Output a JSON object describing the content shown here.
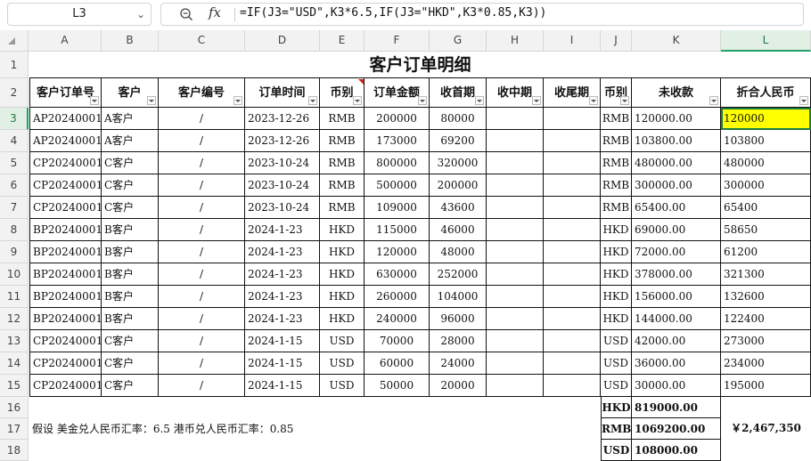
{
  "name_box": "L3",
  "formula": "=IF(J3=\"USD\",K3*6.5,IF(J3=\"HKD\",K3*0.85,K3))",
  "columns": [
    "A",
    "B",
    "C",
    "D",
    "E",
    "F",
    "G",
    "H",
    "I",
    "J",
    "K",
    "L"
  ],
  "row_numbers": [
    "1",
    "2",
    "3",
    "4",
    "5",
    "6",
    "7",
    "8",
    "9",
    "10",
    "11",
    "12",
    "13",
    "14",
    "15",
    "16",
    "17",
    "18"
  ],
  "title": "客户订单明细",
  "headers": [
    "客户订单号",
    "客户",
    "客户编号",
    "订单时间",
    "币别",
    "订单金额",
    "收首期",
    "收中期",
    "收尾期",
    "币别",
    "未收款",
    "折合人民币"
  ],
  "rows": [
    [
      "AP20240001",
      "A客户",
      "/",
      "2023-12-26",
      "RMB",
      "200000",
      "80000",
      "",
      "",
      "RMB",
      "120000.00",
      "120000"
    ],
    [
      "AP20240001",
      "A客户",
      "/",
      "2023-12-26",
      "RMB",
      "173000",
      "69200",
      "",
      "",
      "RMB",
      "103800.00",
      "103800"
    ],
    [
      "CP20240001",
      "C客户",
      "/",
      "2023-10-24",
      "RMB",
      "800000",
      "320000",
      "",
      "",
      "RMB",
      "480000.00",
      "480000"
    ],
    [
      "CP20240001",
      "C客户",
      "/",
      "2023-10-24",
      "RMB",
      "500000",
      "200000",
      "",
      "",
      "RMB",
      "300000.00",
      "300000"
    ],
    [
      "CP20240001",
      "C客户",
      "/",
      "2023-10-24",
      "RMB",
      "109000",
      "43600",
      "",
      "",
      "RMB",
      "65400.00",
      "65400"
    ],
    [
      "BP20240001",
      "B客户",
      "/",
      "2024-1-23",
      "HKD",
      "115000",
      "46000",
      "",
      "",
      "HKD",
      "69000.00",
      "58650"
    ],
    [
      "BP20240001",
      "B客户",
      "/",
      "2024-1-23",
      "HKD",
      "120000",
      "48000",
      "",
      "",
      "HKD",
      "72000.00",
      "61200"
    ],
    [
      "BP20240001",
      "B客户",
      "/",
      "2024-1-23",
      "HKD",
      "630000",
      "252000",
      "",
      "",
      "HKD",
      "378000.00",
      "321300"
    ],
    [
      "BP20240001",
      "B客户",
      "/",
      "2024-1-23",
      "HKD",
      "260000",
      "104000",
      "",
      "",
      "HKD",
      "156000.00",
      "132600"
    ],
    [
      "BP20240001",
      "B客户",
      "/",
      "2024-1-23",
      "HKD",
      "240000",
      "96000",
      "",
      "",
      "HKD",
      "144000.00",
      "122400"
    ],
    [
      "CP20240001",
      "C客户",
      "/",
      "2024-1-15",
      "USD",
      "70000",
      "28000",
      "",
      "",
      "USD",
      "42000.00",
      "273000"
    ],
    [
      "CP20240001",
      "C客户",
      "/",
      "2024-1-15",
      "USD",
      "60000",
      "24000",
      "",
      "",
      "USD",
      "36000.00",
      "234000"
    ],
    [
      "CP20240001",
      "C客户",
      "/",
      "2024-1-15",
      "USD",
      "50000",
      "20000",
      "",
      "",
      "USD",
      "30000.00",
      "195000"
    ]
  ],
  "summary": [
    {
      "currency": "HKD",
      "amount": "819000.00"
    },
    {
      "currency": "RMB",
      "amount": "1069200.00"
    },
    {
      "currency": "USD",
      "amount": "108000.00"
    }
  ],
  "total_rmb": "￥2,467,350",
  "note": "假设 美金兑人民币汇率：6.5  港币兑人民币汇率：0.85",
  "colors": {
    "selection": "#21a366",
    "highlight": "#ffff00"
  }
}
